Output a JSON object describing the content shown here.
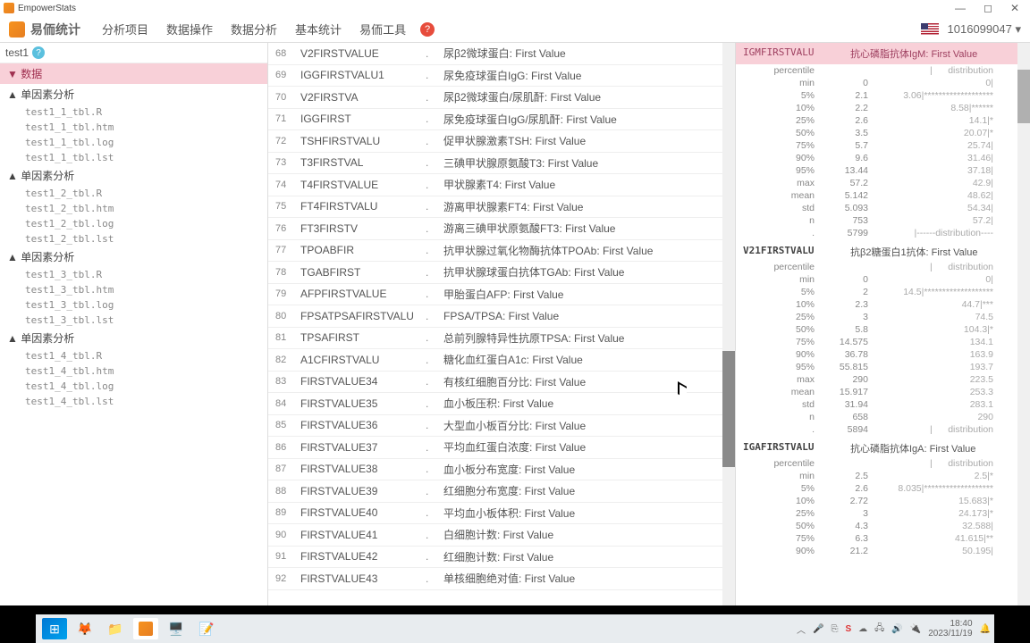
{
  "titlebar": {
    "app_name": "EmpowerStats"
  },
  "menubar": {
    "brand": "易侕统计",
    "items": [
      "分析项目",
      "数据操作",
      "数据分析",
      "基本统计",
      "易侕工具"
    ],
    "account": "1016099047",
    "caret": "▾"
  },
  "sidebar": {
    "session": "test1",
    "data_label": "▼ 数据",
    "groups": [
      {
        "title": "▲ 单因素分析",
        "files": [
          "test1_1_tbl.R",
          "test1_1_tbl.htm",
          "test1_1_tbl.log",
          "test1_1_tbl.lst"
        ]
      },
      {
        "title": "▲ 单因素分析",
        "files": [
          "test1_2_tbl.R",
          "test1_2_tbl.htm",
          "test1_2_tbl.log",
          "test1_2_tbl.lst"
        ]
      },
      {
        "title": "▲ 单因素分析",
        "files": [
          "test1_3_tbl.R",
          "test1_3_tbl.htm",
          "test1_3_tbl.log",
          "test1_3_tbl.lst"
        ]
      },
      {
        "title": "▲ 单因素分析",
        "files": [
          "test1_4_tbl.R",
          "test1_4_tbl.htm",
          "test1_4_tbl.log",
          "test1_4_tbl.lst"
        ]
      }
    ]
  },
  "center_rows": [
    {
      "i": "68",
      "c": "V2FIRSTVALUE",
      "d": "尿β2微球蛋白: First Value"
    },
    {
      "i": "69",
      "c": "IGGFIRSTVALU1",
      "d": "尿免疫球蛋白IgG: First Value"
    },
    {
      "i": "70",
      "c": "V2FIRSTVA",
      "d": "尿β2微球蛋白/尿肌酐: First Value"
    },
    {
      "i": "71",
      "c": "IGGFIRST",
      "d": "尿免疫球蛋白IgG/尿肌酐: First Value"
    },
    {
      "i": "72",
      "c": "TSHFIRSTVALU",
      "d": "促甲状腺激素TSH: First Value"
    },
    {
      "i": "73",
      "c": "T3FIRSTVAL",
      "d": "三碘甲状腺原氨酸T3: First Value"
    },
    {
      "i": "74",
      "c": "T4FIRSTVALUE",
      "d": "甲状腺素T4: First Value"
    },
    {
      "i": "75",
      "c": "FT4FIRSTVALU",
      "d": "游离甲状腺素FT4: First Value"
    },
    {
      "i": "76",
      "c": "FT3FIRSTV",
      "d": "游离三碘甲状原氨酸FT3: First Value"
    },
    {
      "i": "77",
      "c": "TPOABFIR",
      "d": "抗甲状腺过氧化物酶抗体TPOAb: First Value"
    },
    {
      "i": "78",
      "c": "TGABFIRST",
      "d": "抗甲状腺球蛋白抗体TGAb: First Value"
    },
    {
      "i": "79",
      "c": "AFPFIRSTVALUE",
      "d": "甲胎蛋白AFP: First Value"
    },
    {
      "i": "80",
      "c": "FPSATPSAFIRSTVALU",
      "d": "FPSA/TPSA: First Value"
    },
    {
      "i": "81",
      "c": "TPSAFIRST",
      "d": "总前列腺特异性抗原TPSA: First Value"
    },
    {
      "i": "82",
      "c": "A1CFIRSTVALU",
      "d": "糖化血红蛋白A1c: First Value"
    },
    {
      "i": "83",
      "c": "FIRSTVALUE34",
      "d": "有核红细胞百分比: First Value"
    },
    {
      "i": "84",
      "c": "FIRSTVALUE35",
      "d": "血小板压积: First Value"
    },
    {
      "i": "85",
      "c": "FIRSTVALUE36",
      "d": "大型血小板百分比: First Value"
    },
    {
      "i": "86",
      "c": "FIRSTVALUE37",
      "d": "平均血红蛋白浓度: First Value"
    },
    {
      "i": "87",
      "c": "FIRSTVALUE38",
      "d": "血小板分布宽度: First Value"
    },
    {
      "i": "88",
      "c": "FIRSTVALUE39",
      "d": "红细胞分布宽度: First Value"
    },
    {
      "i": "89",
      "c": "FIRSTVALUE40",
      "d": "平均血小板体积: First Value"
    },
    {
      "i": "90",
      "c": "FIRSTVALUE41",
      "d": "白细胞计数: First Value"
    },
    {
      "i": "91",
      "c": "FIRSTVALUE42",
      "d": "红细胞计数: First Value"
    },
    {
      "i": "92",
      "c": "FIRSTVALUE43",
      "d": "单核细胞绝对值: First Value"
    }
  ],
  "right": {
    "blocks": [
      {
        "code": "IGMFIRSTVALU",
        "label": "抗心磷脂抗体IgM: First Value",
        "highlight": true,
        "rows": [
          [
            "percentile",
            "",
            "|      distribution"
          ],
          [
            "min",
            "0",
            "0|"
          ],
          [
            "5%",
            "2.1",
            "3.06|*******************"
          ],
          [
            "10%",
            "2.2",
            "8.58|******"
          ],
          [
            "25%",
            "2.6",
            "14.1|*"
          ],
          [
            "50%",
            "3.5",
            "20.07|*"
          ],
          [
            "75%",
            "5.7",
            "25.74|"
          ],
          [
            "90%",
            "9.6",
            "31.46|"
          ],
          [
            "95%",
            "13.44",
            "37.18|"
          ],
          [
            "max",
            "57.2",
            "42.9|"
          ],
          [
            "mean",
            "5.142",
            "48.62|"
          ],
          [
            "std",
            "5.093",
            "54.34|"
          ],
          [
            "n",
            "753",
            "57.2|"
          ],
          [
            ".",
            "5799",
            "|------distribution----"
          ]
        ]
      },
      {
        "code": "V21FIRSTVALU",
        "label": "抗β2糖蛋白1抗体: First Value",
        "highlight": false,
        "rows": [
          [
            "percentile",
            "",
            "|      distribution"
          ],
          [
            "min",
            "0",
            "0|"
          ],
          [
            "5%",
            "2",
            "14.5|*******************"
          ],
          [
            "10%",
            "2.3",
            "44.7|***"
          ],
          [
            "25%",
            "3",
            "74.5"
          ],
          [
            "50%",
            "5.8",
            "104.3|*"
          ],
          [
            "75%",
            "14.575",
            "134.1"
          ],
          [
            "90%",
            "36.78",
            "163.9"
          ],
          [
            "95%",
            "55.815",
            "193.7"
          ],
          [
            "max",
            "290",
            "223.5"
          ],
          [
            "mean",
            "15.917",
            "253.3"
          ],
          [
            "std",
            "31.94",
            "283.1"
          ],
          [
            "n",
            "658",
            "290"
          ],
          [
            ".",
            "5894",
            "|      distribution"
          ]
        ]
      },
      {
        "code": "IGAFIRSTVALU",
        "label": "抗心磷脂抗体IgA: First Value",
        "highlight": false,
        "rows": [
          [
            "percentile",
            "",
            "|      distribution"
          ],
          [
            "min",
            "2.5",
            "2.5|*"
          ],
          [
            "5%",
            "2.6",
            "8.035|*******************"
          ],
          [
            "10%",
            "2.72",
            "15.683|*"
          ],
          [
            "25%",
            "3",
            "24.173|*"
          ],
          [
            "50%",
            "4.3",
            "32.588|"
          ],
          [
            "75%",
            "6.3",
            "41.615|**"
          ],
          [
            "90%",
            "21.2",
            "50.195|"
          ]
        ]
      }
    ]
  },
  "taskbar": {
    "time": "18:40",
    "date": "2023/11/19"
  }
}
